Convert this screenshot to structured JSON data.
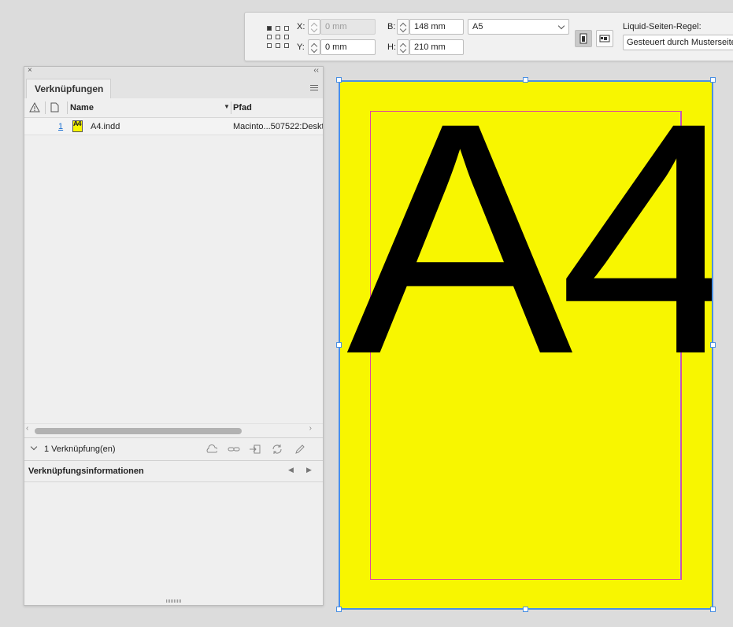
{
  "control_bar": {
    "x_label": "X:",
    "x_value": "0 mm",
    "y_label": "Y:",
    "y_value": "0 mm",
    "w_label": "B:",
    "w_value": "148 mm",
    "h_label": "H:",
    "h_value": "210 mm",
    "page_size": "A5",
    "liquid_rule_label": "Liquid-Seiten-Regel:",
    "liquid_rule_value": "Gesteuert durch Musterseite"
  },
  "links_panel": {
    "tab_label": "Verknüpfungen",
    "col_name": "Name",
    "col_path": "Pfad",
    "rows": [
      {
        "page": "1",
        "thumb_text": "A4",
        "name": "A4.indd",
        "path": "Macinto...507522:Deskt"
      }
    ],
    "summary": "1 Verknüpfung(en)",
    "info_title": "Verknüpfungsinformationen"
  },
  "page_content": {
    "text": "A4"
  },
  "colors": {
    "page_bg": "#f8f600",
    "selection": "#4a90e2",
    "margin": "#e0479a"
  }
}
